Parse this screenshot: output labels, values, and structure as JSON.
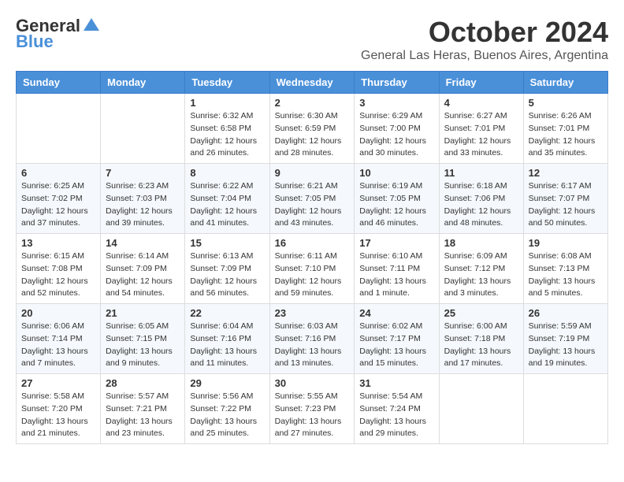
{
  "logo": {
    "general": "General",
    "blue": "Blue"
  },
  "title": "October 2024",
  "location": "General Las Heras, Buenos Aires, Argentina",
  "days_of_week": [
    "Sunday",
    "Monday",
    "Tuesday",
    "Wednesday",
    "Thursday",
    "Friday",
    "Saturday"
  ],
  "weeks": [
    [
      {
        "day": "",
        "info": ""
      },
      {
        "day": "",
        "info": ""
      },
      {
        "day": "1",
        "info": "Sunrise: 6:32 AM\nSunset: 6:58 PM\nDaylight: 12 hours and 26 minutes."
      },
      {
        "day": "2",
        "info": "Sunrise: 6:30 AM\nSunset: 6:59 PM\nDaylight: 12 hours and 28 minutes."
      },
      {
        "day": "3",
        "info": "Sunrise: 6:29 AM\nSunset: 7:00 PM\nDaylight: 12 hours and 30 minutes."
      },
      {
        "day": "4",
        "info": "Sunrise: 6:27 AM\nSunset: 7:01 PM\nDaylight: 12 hours and 33 minutes."
      },
      {
        "day": "5",
        "info": "Sunrise: 6:26 AM\nSunset: 7:01 PM\nDaylight: 12 hours and 35 minutes."
      }
    ],
    [
      {
        "day": "6",
        "info": "Sunrise: 6:25 AM\nSunset: 7:02 PM\nDaylight: 12 hours and 37 minutes."
      },
      {
        "day": "7",
        "info": "Sunrise: 6:23 AM\nSunset: 7:03 PM\nDaylight: 12 hours and 39 minutes."
      },
      {
        "day": "8",
        "info": "Sunrise: 6:22 AM\nSunset: 7:04 PM\nDaylight: 12 hours and 41 minutes."
      },
      {
        "day": "9",
        "info": "Sunrise: 6:21 AM\nSunset: 7:05 PM\nDaylight: 12 hours and 43 minutes."
      },
      {
        "day": "10",
        "info": "Sunrise: 6:19 AM\nSunset: 7:05 PM\nDaylight: 12 hours and 46 minutes."
      },
      {
        "day": "11",
        "info": "Sunrise: 6:18 AM\nSunset: 7:06 PM\nDaylight: 12 hours and 48 minutes."
      },
      {
        "day": "12",
        "info": "Sunrise: 6:17 AM\nSunset: 7:07 PM\nDaylight: 12 hours and 50 minutes."
      }
    ],
    [
      {
        "day": "13",
        "info": "Sunrise: 6:15 AM\nSunset: 7:08 PM\nDaylight: 12 hours and 52 minutes."
      },
      {
        "day": "14",
        "info": "Sunrise: 6:14 AM\nSunset: 7:09 PM\nDaylight: 12 hours and 54 minutes."
      },
      {
        "day": "15",
        "info": "Sunrise: 6:13 AM\nSunset: 7:09 PM\nDaylight: 12 hours and 56 minutes."
      },
      {
        "day": "16",
        "info": "Sunrise: 6:11 AM\nSunset: 7:10 PM\nDaylight: 12 hours and 59 minutes."
      },
      {
        "day": "17",
        "info": "Sunrise: 6:10 AM\nSunset: 7:11 PM\nDaylight: 13 hours and 1 minute."
      },
      {
        "day": "18",
        "info": "Sunrise: 6:09 AM\nSunset: 7:12 PM\nDaylight: 13 hours and 3 minutes."
      },
      {
        "day": "19",
        "info": "Sunrise: 6:08 AM\nSunset: 7:13 PM\nDaylight: 13 hours and 5 minutes."
      }
    ],
    [
      {
        "day": "20",
        "info": "Sunrise: 6:06 AM\nSunset: 7:14 PM\nDaylight: 13 hours and 7 minutes."
      },
      {
        "day": "21",
        "info": "Sunrise: 6:05 AM\nSunset: 7:15 PM\nDaylight: 13 hours and 9 minutes."
      },
      {
        "day": "22",
        "info": "Sunrise: 6:04 AM\nSunset: 7:16 PM\nDaylight: 13 hours and 11 minutes."
      },
      {
        "day": "23",
        "info": "Sunrise: 6:03 AM\nSunset: 7:16 PM\nDaylight: 13 hours and 13 minutes."
      },
      {
        "day": "24",
        "info": "Sunrise: 6:02 AM\nSunset: 7:17 PM\nDaylight: 13 hours and 15 minutes."
      },
      {
        "day": "25",
        "info": "Sunrise: 6:00 AM\nSunset: 7:18 PM\nDaylight: 13 hours and 17 minutes."
      },
      {
        "day": "26",
        "info": "Sunrise: 5:59 AM\nSunset: 7:19 PM\nDaylight: 13 hours and 19 minutes."
      }
    ],
    [
      {
        "day": "27",
        "info": "Sunrise: 5:58 AM\nSunset: 7:20 PM\nDaylight: 13 hours and 21 minutes."
      },
      {
        "day": "28",
        "info": "Sunrise: 5:57 AM\nSunset: 7:21 PM\nDaylight: 13 hours and 23 minutes."
      },
      {
        "day": "29",
        "info": "Sunrise: 5:56 AM\nSunset: 7:22 PM\nDaylight: 13 hours and 25 minutes."
      },
      {
        "day": "30",
        "info": "Sunrise: 5:55 AM\nSunset: 7:23 PM\nDaylight: 13 hours and 27 minutes."
      },
      {
        "day": "31",
        "info": "Sunrise: 5:54 AM\nSunset: 7:24 PM\nDaylight: 13 hours and 29 minutes."
      },
      {
        "day": "",
        "info": ""
      },
      {
        "day": "",
        "info": ""
      }
    ]
  ]
}
